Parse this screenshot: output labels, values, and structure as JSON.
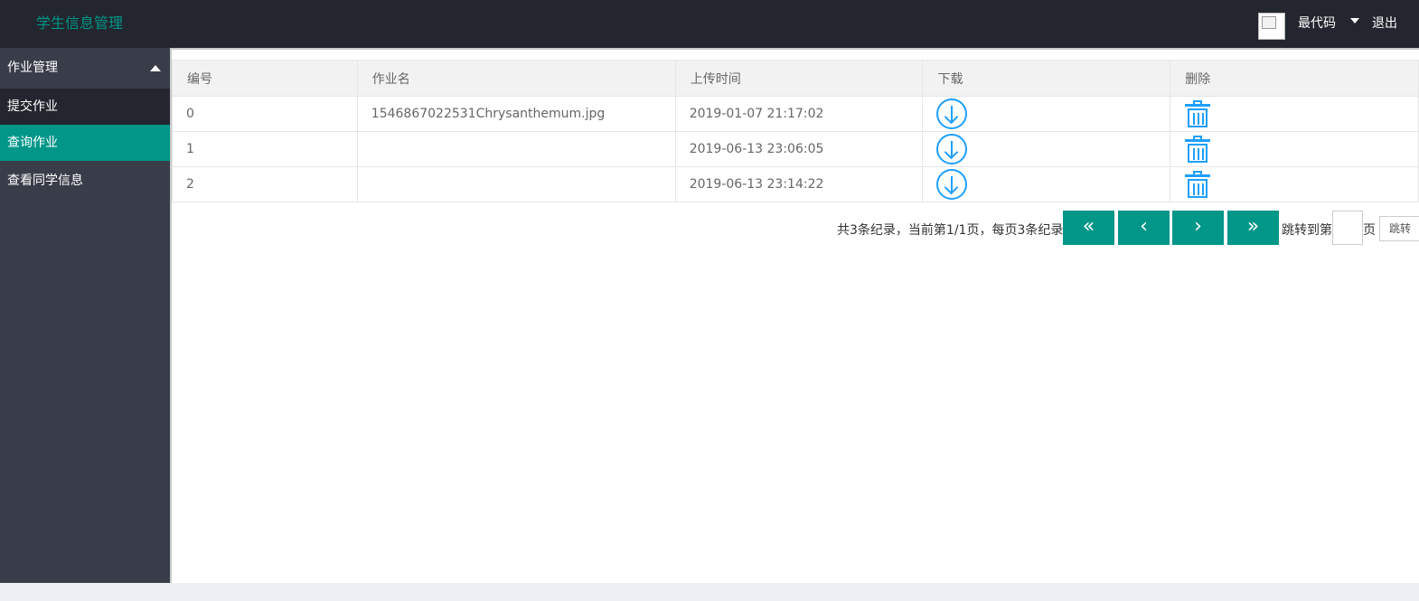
{
  "header": {
    "brand": "学生信息管理",
    "user_name": "最代码",
    "logout": "退出"
  },
  "sidebar": {
    "group_label": "作业管理",
    "sub_items": [
      {
        "label": "提交作业",
        "active": false
      },
      {
        "label": "查询作业",
        "active": true
      }
    ],
    "other_item": "查看同学信息"
  },
  "table": {
    "headers": [
      "编号",
      "作业名",
      "上传时间",
      "下载",
      "删除"
    ],
    "rows": [
      {
        "id": "0",
        "name": "1546867022531Chrysanthemum.jpg",
        "time": "2019-01-07 21:17:02"
      },
      {
        "id": "1",
        "name": "",
        "time": "2019-06-13 23:06:05"
      },
      {
        "id": "2",
        "name": "",
        "time": "2019-06-13 23:14:22"
      }
    ]
  },
  "pagination": {
    "info": "共3条纪录，当前第1/1页，每页3条纪录",
    "first": "«",
    "prev": "‹",
    "next": "›",
    "last": "»",
    "jump_label": "跳转到第",
    "page_label": "页",
    "jump_button": "跳转",
    "jump_value": ""
  },
  "colors": {
    "accent": "#009688",
    "topbar": "#23262e",
    "sidebar": "#393d49",
    "icon": "#1e9fff"
  }
}
